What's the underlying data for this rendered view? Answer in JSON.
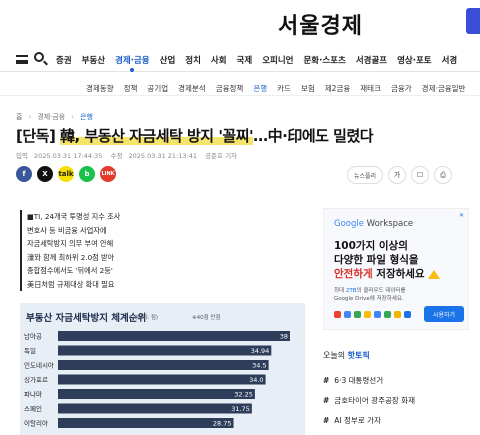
{
  "site": {
    "logo": "서울경제"
  },
  "gnb": {
    "items": [
      {
        "label": "증권",
        "active": false
      },
      {
        "label": "부동산",
        "active": false
      },
      {
        "label": "경제·금융",
        "active": true
      },
      {
        "label": "산업",
        "active": false
      },
      {
        "label": "정치",
        "active": false
      },
      {
        "label": "사회",
        "active": false
      },
      {
        "label": "국제",
        "active": false
      },
      {
        "label": "오피니언",
        "active": false
      },
      {
        "label": "문화·스포츠",
        "active": false
      },
      {
        "label": "서경골프",
        "active": false
      },
      {
        "label": "영상·포토",
        "active": false
      },
      {
        "label": "서경",
        "active": false
      }
    ]
  },
  "subnav": {
    "items": [
      {
        "label": "경제동향",
        "active": false
      },
      {
        "label": "정책",
        "active": false
      },
      {
        "label": "공기업",
        "active": false
      },
      {
        "label": "경제분석",
        "active": false
      },
      {
        "label": "금융정책",
        "active": false
      },
      {
        "label": "은행",
        "active": true
      },
      {
        "label": "카드",
        "active": false
      },
      {
        "label": "보험",
        "active": false
      },
      {
        "label": "제2금융",
        "active": false
      },
      {
        "label": "재테크",
        "active": false
      },
      {
        "label": "금융가",
        "active": false
      },
      {
        "label": "경제·금융일반",
        "active": false
      }
    ]
  },
  "breadcrumb": {
    "home": "홈",
    "section": "경제·금융",
    "current": "은행"
  },
  "article": {
    "headline_prefix": "[단독] ",
    "headline_highlight": "韓, 부동산 자금세탁 방지 '꼴찌'",
    "headline_suffix": "…中·印에도 밀렸다",
    "input_label": "입력",
    "input_time": "2025.03.31 17:44:35",
    "edit_label": "수정",
    "edit_time": "2025.03.31 21:13:41",
    "reporter": "공준호 기자",
    "bullets": [
      "■TI, 24개국 투명성 지수 조사",
      "변호사 등 비금융 사업자에",
      "자금세탁방지 의무 부여 안해",
      "濠와 함께 최하위 2.0점 받아",
      "종합점수에서도 '뒤에서 2등'",
      "美日처럼 규제대상 확대 필요"
    ]
  },
  "share": {
    "fb": "f",
    "x": "X",
    "talk": "talk",
    "band": "b",
    "link": "LINK"
  },
  "tools": {
    "news_follow": "뉴스플리",
    "font": "가",
    "bookmark": "☐",
    "print": "⎙"
  },
  "chart_data": {
    "type": "bar",
    "title": "부동산 자금세탁방지 체계순위",
    "unit": "(단위: 점)",
    "note": "※40점 만점",
    "categories": [
      "남아공",
      "독일",
      "인도네시아",
      "싱가포르",
      "파나마",
      "스페인",
      "이탈리아"
    ],
    "values": [
      38,
      34.94,
      34.5,
      34.0,
      32.25,
      31.75,
      28.75
    ],
    "value_labels": [
      "38",
      "34.94",
      "34.5",
      "34.0",
      "32.25",
      "31.75",
      "28.75"
    ],
    "xlim": [
      0,
      38
    ],
    "bar_color": "#2d3d5a"
  },
  "ad": {
    "close": "✕",
    "brand_google": "Google",
    "brand_ws": " Workspace",
    "head_line1": "100가지 이상의",
    "head_line2": "다양한 파일 형식을",
    "head_line3_red": "안전하게",
    "head_line3_rest": " 저장하세요",
    "sub_pre": "최대 ",
    "sub_blue": "2TB",
    "sub_post": "의 클라우드 데이터를",
    "sub_line2": "Google Drive에 저장하세요.",
    "cta": "사용하기"
  },
  "hot_topics": {
    "title_pre": "오늘의 ",
    "title_bold": "핫토픽",
    "items": [
      "6·3 대통령선거",
      "금호타이어 광주공장 화재",
      "AI 정부로 가자"
    ]
  }
}
